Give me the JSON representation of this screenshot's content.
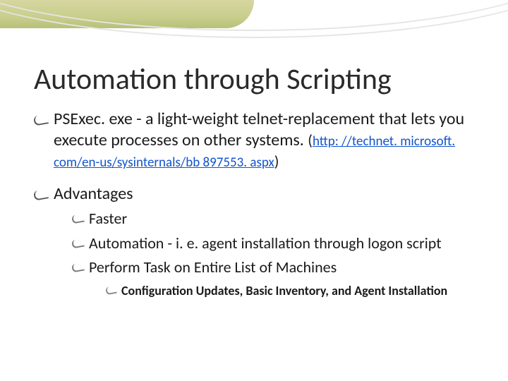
{
  "title": "Automation through Scripting",
  "bullets": {
    "b1_main": "PSExec. exe - a light-weight telnet-replacement that lets you execute processes on other systems. ",
    "b1_link": "http: //technet. microsoft. com/en-us/sysinternals/bb 897553. aspx",
    "b2": "Advantages",
    "b2_sub": {
      "s1": "Faster",
      "s2": "Automation - i. e. agent installation through logon script",
      "s3": "Perform Task on Entire List of Machines",
      "s3_sub": {
        "t1": "Configuration Updates, Basic Inventory, and Agent Installation"
      }
    }
  }
}
